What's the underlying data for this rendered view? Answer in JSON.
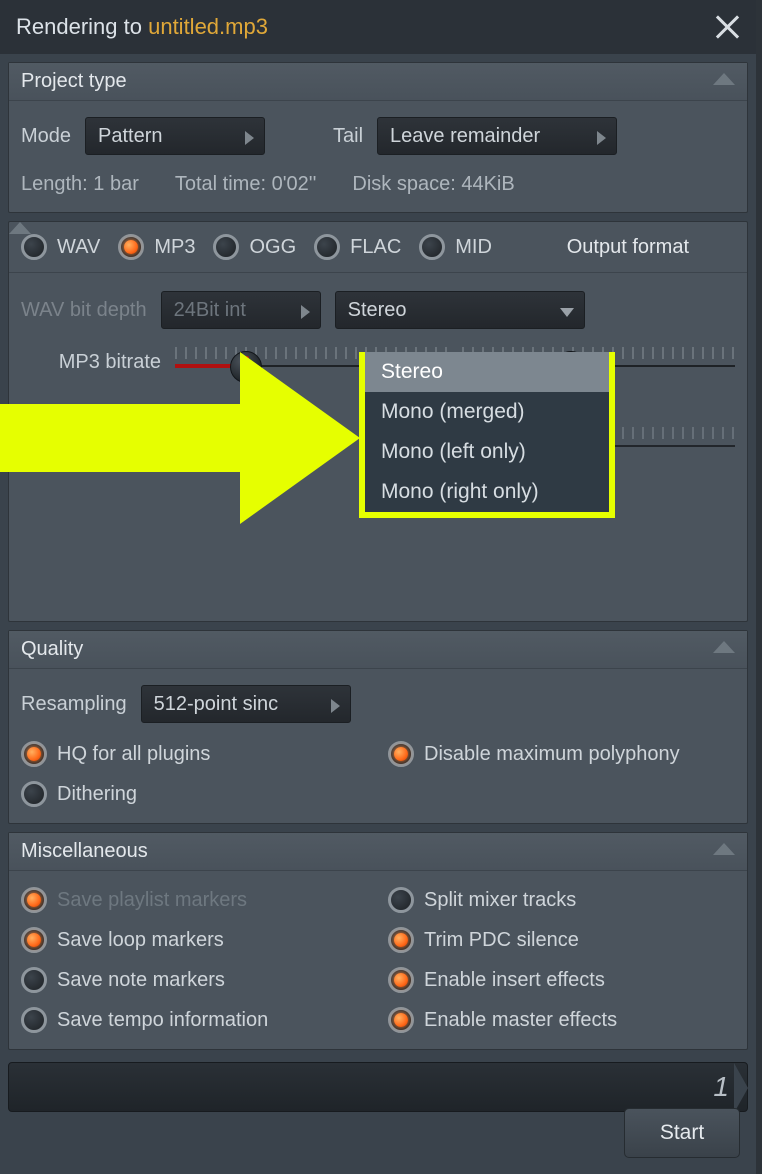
{
  "title_prefix": "Rendering to ",
  "filename": "untitled.mp3",
  "project_type": {
    "header": "Project type",
    "mode_label": "Mode",
    "mode_value": "Pattern",
    "tail_label": "Tail",
    "tail_value": "Leave remainder",
    "length": "Length: 1 bar",
    "total_time": "Total time: 0'02''",
    "disk_space": "Disk space: 44KiB"
  },
  "output_format": {
    "title": "Output format",
    "options": [
      {
        "label": "WAV",
        "on": false
      },
      {
        "label": "MP3",
        "on": true
      },
      {
        "label": "OGG",
        "on": false
      },
      {
        "label": "FLAC",
        "on": false
      },
      {
        "label": "MID",
        "on": false
      }
    ],
    "wav_depth_label": "WAV bit depth",
    "wav_depth_value": "24Bit int",
    "channels_value": "Stereo",
    "channels_menu": [
      "Stereo",
      "Mono (merged)",
      "Mono (left only)",
      "Mono (right only)"
    ],
    "bitrate_label": "MP3 bitrate"
  },
  "quality": {
    "header": "Quality",
    "resampling_label": "Resampling",
    "resampling_value": "512-point sinc",
    "hq": "HQ for all plugins",
    "disable_poly": "Disable maximum polyphony",
    "dithering": "Dithering"
  },
  "misc": {
    "header": "Miscellaneous",
    "items": [
      {
        "label": "Save playlist markers",
        "on": true
      },
      {
        "label": "Split mixer tracks",
        "on": false
      },
      {
        "label": "Save loop markers",
        "on": true
      },
      {
        "label": "Trim PDC silence",
        "on": true
      },
      {
        "label": "Save note markers",
        "on": false
      },
      {
        "label": "Enable insert effects",
        "on": true
      },
      {
        "label": "Save tempo information",
        "on": false
      },
      {
        "label": "Enable master effects",
        "on": true
      }
    ]
  },
  "progress_value": "1",
  "start_label": "Start"
}
